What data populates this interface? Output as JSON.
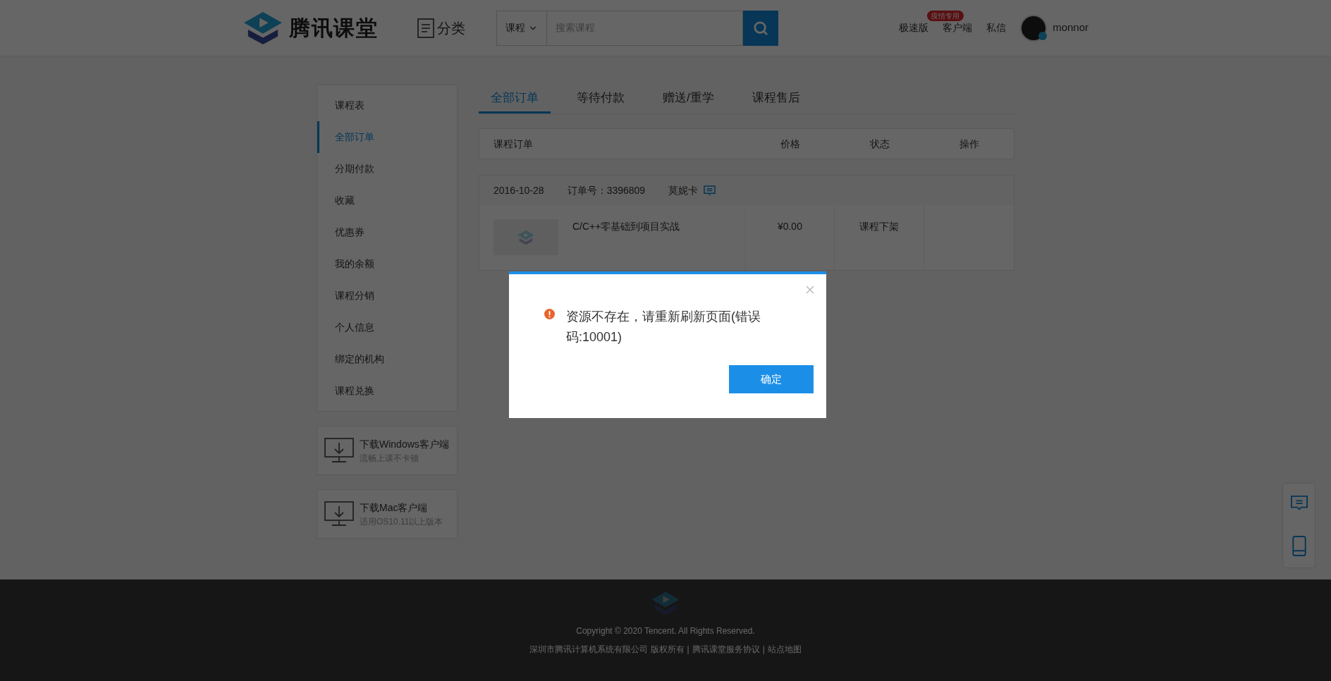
{
  "header": {
    "logo_text": "腾讯课堂",
    "category": "分类",
    "search": {
      "scope": "课程",
      "placeholder": "搜索课程"
    },
    "links": [
      {
        "label": "极速版",
        "badge": "疫情专用"
      },
      {
        "label": "客户端"
      },
      {
        "label": "私信"
      }
    ],
    "user": "monnor"
  },
  "sidebar": {
    "items": [
      {
        "label": "课程表",
        "selected": false
      },
      {
        "label": "全部订单",
        "selected": true
      },
      {
        "label": "分期付款",
        "selected": false
      },
      {
        "label": "收藏",
        "selected": false
      },
      {
        "label": "优惠券",
        "selected": false
      },
      {
        "label": "我的余额",
        "selected": false
      },
      {
        "label": "课程分销",
        "selected": false
      },
      {
        "label": "个人信息",
        "selected": false
      },
      {
        "label": "绑定的机构",
        "selected": false
      },
      {
        "label": "课程兑换",
        "selected": false
      }
    ],
    "downloads": [
      {
        "title": "下载Windows客户端",
        "subtitle": "流畅上课不卡顿"
      },
      {
        "title": "下载Mac客户端",
        "subtitle": "适用OS10.11以上版本"
      }
    ]
  },
  "tabs": [
    {
      "label": "全部订单",
      "selected": true
    },
    {
      "label": "等待付款",
      "selected": false
    },
    {
      "label": "赠送/重学",
      "selected": false
    },
    {
      "label": "课程售后",
      "selected": false
    }
  ],
  "table": {
    "columns": [
      "课程订单",
      "价格",
      "状态",
      "操作"
    ],
    "orders": [
      {
        "date": "2016-10-28",
        "order_no": "订单号：3396809",
        "seller": "莫妮卡",
        "course": "C/C++零基础到项目实战",
        "price": "¥0.00",
        "status": "课程下架"
      }
    ]
  },
  "dialog": {
    "message": "资源不存在，请重新刷新页面(错误码:10001)",
    "button": "确定"
  },
  "footer": {
    "copyright": "Copyright © 2020 Tencent. All Rights Reserved.",
    "company": "深圳市腾讯计算机系统有限公司 版权所有",
    "separator": "|",
    "links": [
      "腾讯课堂服务协议",
      "站点地图"
    ]
  }
}
